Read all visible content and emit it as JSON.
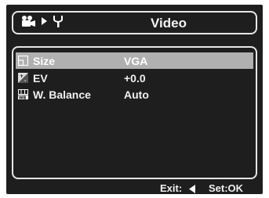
{
  "header": {
    "title": "Video",
    "icons": [
      "video-mode-icon",
      "arrow-right-icon",
      "setup-wrench-icon"
    ]
  },
  "menu": {
    "items": [
      {
        "label": "Size",
        "value": "VGA",
        "icon": "size-icon",
        "selected": true
      },
      {
        "label": "EV",
        "value": "+0.0",
        "icon": "ev-icon",
        "selected": false
      },
      {
        "label": "W. Balance",
        "value": "Auto",
        "icon": "white-balance-icon",
        "selected": false
      }
    ]
  },
  "footer": {
    "exit_label": "Exit:",
    "set_label": "Set:OK",
    "icon": "left-arrow-icon"
  },
  "colors": {
    "screen_bg": "#1e1e1e",
    "border": "#e6e6e6",
    "selection": "#b0b0b0",
    "text": "#f0f0f0"
  }
}
